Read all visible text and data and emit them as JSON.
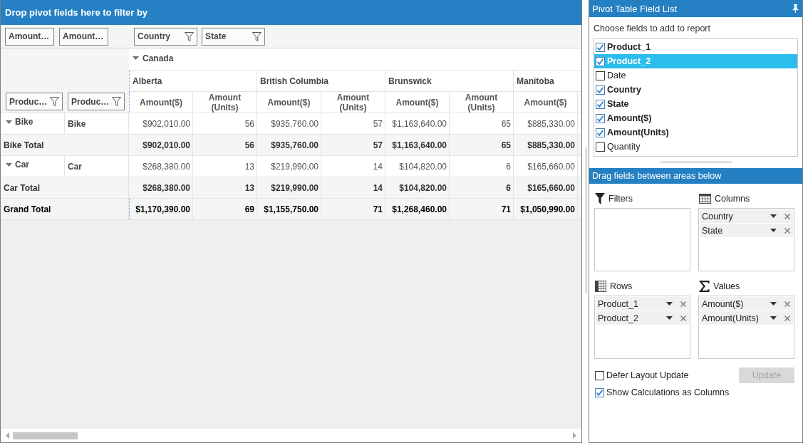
{
  "pivot_grid": {
    "filter_area": {
      "hint": "Drop pivot fields here to filter by"
    },
    "value_fields": [
      {
        "label": "Amount…"
      },
      {
        "label": "Amount…"
      }
    ],
    "column_fields": [
      {
        "label": "Country"
      },
      {
        "label": "State"
      }
    ],
    "row_fields": [
      {
        "label": "Produc…"
      },
      {
        "label": "Produc…"
      }
    ],
    "column_groups": [
      {
        "label": "Canada",
        "expanded": true,
        "children": [
          {
            "label": "Alberta",
            "value_headers": [
              "Amount($)",
              "Amount (Units)"
            ]
          },
          {
            "label": "British Columbia",
            "value_headers": [
              "Amount($)",
              "Amount (Units)"
            ]
          },
          {
            "label": "Brunswick",
            "value_headers": [
              "Amount($)",
              "Amount (Units)"
            ]
          },
          {
            "label": "Manitoba",
            "value_headers": [
              "Amount($)"
            ]
          }
        ]
      }
    ],
    "rows": [
      {
        "kind": "group",
        "label": "Bike",
        "expanded": true,
        "children": [
          {
            "label": "Bike",
            "cells": [
              "$902,010.00",
              "56",
              "$935,760.00",
              "57",
              "$1,163,640.00",
              "65",
              "$885,330.00"
            ]
          }
        ]
      },
      {
        "kind": "total",
        "label": "Bike Total",
        "cells": [
          "$902,010.00",
          "56",
          "$935,760.00",
          "57",
          "$1,163,640.00",
          "65",
          "$885,330.00"
        ]
      },
      {
        "kind": "group",
        "label": "Car",
        "expanded": true,
        "children": [
          {
            "label": "Car",
            "cells": [
              "$268,380.00",
              "13",
              "$219,990.00",
              "14",
              "$104,820.00",
              "6",
              "$165,660.00"
            ]
          }
        ]
      },
      {
        "kind": "total",
        "label": "Car Total",
        "cells": [
          "$268,380.00",
          "13",
          "$219,990.00",
          "14",
          "$104,820.00",
          "6",
          "$165,660.00"
        ]
      },
      {
        "kind": "grand_total",
        "label": "Grand Total",
        "cells": [
          "$1,170,390.00",
          "69",
          "$1,155,750.00",
          "71",
          "$1,268,460.00",
          "71",
          "$1,050,990.00"
        ]
      }
    ]
  },
  "field_list": {
    "title": "Pivot Table Field List",
    "prompt": "Choose fields to add to report",
    "fields": [
      {
        "label": "Product_1",
        "checked": true,
        "selected": false
      },
      {
        "label": "Product_2",
        "checked": true,
        "selected": true
      },
      {
        "label": "Date",
        "checked": false,
        "selected": false
      },
      {
        "label": "Country",
        "checked": true,
        "selected": false
      },
      {
        "label": "State",
        "checked": true,
        "selected": false
      },
      {
        "label": "Amount($)",
        "checked": true,
        "selected": false
      },
      {
        "label": "Amount(Units)",
        "checked": true,
        "selected": false
      },
      {
        "label": "Quantity",
        "checked": false,
        "selected": false
      }
    ],
    "areas_hint": "Drag fields between areas below",
    "areas": [
      {
        "kind": "filters",
        "label": "Filters"
      },
      {
        "kind": "columns",
        "label": "Columns",
        "items": [
          {
            "label": "Country"
          },
          {
            "label": "State"
          }
        ]
      },
      {
        "kind": "rows",
        "label": "Rows",
        "items": [
          {
            "label": "Product_1"
          },
          {
            "label": "Product_2"
          }
        ]
      },
      {
        "kind": "values",
        "label": "Values",
        "items": [
          {
            "label": "Amount($)"
          },
          {
            "label": "Amount(Units)"
          }
        ]
      }
    ],
    "options": [
      {
        "label": "Defer Layout Update",
        "checked": false
      },
      {
        "label": "Show Calculations as Columns",
        "checked": true
      }
    ],
    "update_button": {
      "label": "Update",
      "disabled": true
    }
  }
}
